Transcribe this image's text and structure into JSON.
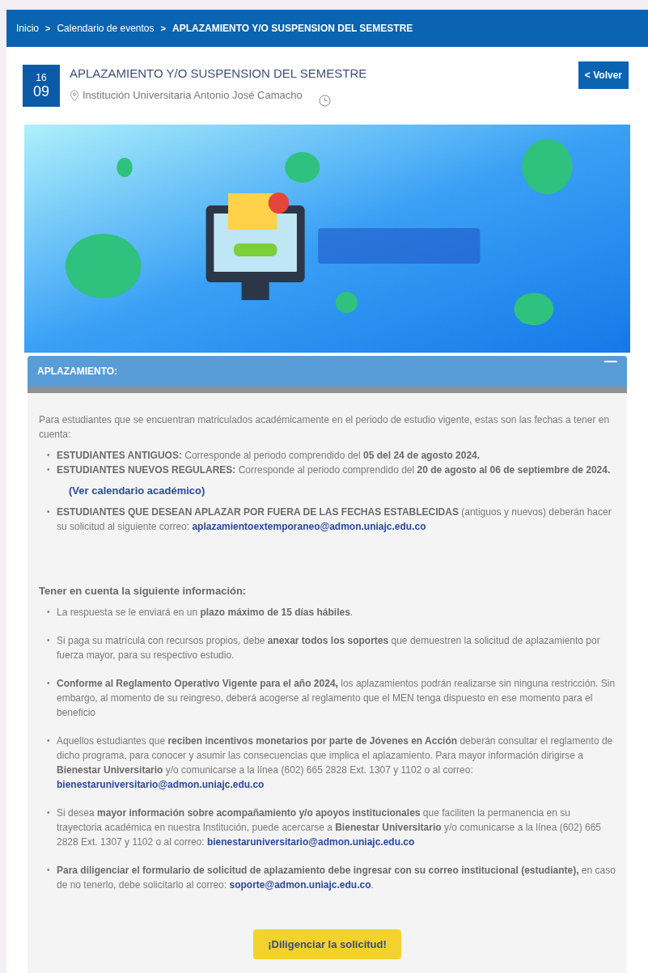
{
  "breadcrumb": [
    {
      "label": "Inicio",
      "current": false
    },
    {
      "label": "Calendario de eventos",
      "current": false
    },
    {
      "label": "APLAZAMIENTO Y/O SUSPENSION DEL SEMESTRE",
      "current": true
    }
  ],
  "breadcrumb_separator": ">",
  "bullet": "•",
  "event": {
    "day": "16",
    "month": "09",
    "title": "APLAZAMIENTO Y/O SUSPENSION DEL SEMESTRE",
    "location": "Institución Universitaria Antonio José Camacho"
  },
  "back_button": "< Volver",
  "panel": {
    "title": "APLAZAMIENTO:",
    "expanded": true,
    "intro": "Para estudiantes que se encuentran matriculados académicamente en el periodo de estudio vigente, estas son las fechas a tener en cuenta:",
    "dates": [
      [
        {
          "kind": "bold",
          "text": "ESTUDIANTES ANTIGUOS:"
        },
        {
          "kind": "plain",
          "text": " Corresponde al periodo comprendido del "
        },
        {
          "kind": "bold",
          "text": "05 del 24 de agosto 2024."
        }
      ],
      [
        {
          "kind": "bold",
          "text": "ESTUDIANTES NUEVOS REGULARES:"
        },
        {
          "kind": "plain",
          "text": " Corresponde al periodo comprendido del "
        },
        {
          "kind": "bold",
          "text": "20 de agosto al 06 de septiembre de 2024."
        }
      ]
    ],
    "calendar_link": "(Ver calendario académico)",
    "late": [
      [
        {
          "kind": "bold",
          "text": "ESTUDIANTES QUE DESEAN APLAZAR POR FUERA DE LAS FECHAS ESTABLECIDAS"
        },
        {
          "kind": "plain",
          "text": " (antiguos y nuevos) deberán hacer su solicitud al siguiente correo: "
        },
        {
          "kind": "link",
          "text": "aplazamientoextemporaneo@admon.uniajc.edu.co"
        }
      ]
    ],
    "info_heading": "Tener en cuenta la siguiente información:",
    "info": [
      [
        {
          "kind": "plain",
          "text": "La respuesta se le enviará en un "
        },
        {
          "kind": "bold",
          "text": "plazo máximo de 15 días hábiles"
        },
        {
          "kind": "plain",
          "text": "."
        }
      ],
      [
        {
          "kind": "plain",
          "text": "Si paga su matrícula con recursos propios, debe "
        },
        {
          "kind": "bold",
          "text": "anexar todos los soportes"
        },
        {
          "kind": "plain",
          "text": " que demuestren la solicitud de aplazamiento por fuerza mayor, para su respectivo estudio."
        }
      ],
      [
        {
          "kind": "bold",
          "text": "Conforme al Reglamento Operativo Vigente para el año 2024,"
        },
        {
          "kind": "plain",
          "text": " los aplazamientos podrán realizarse sin ninguna restricción. Sin embargo, al momento de su reingreso, deberá acogerse al reglamento que el MEN tenga dispuesto en ese momento para el beneficio"
        }
      ],
      [
        {
          "kind": "plain",
          "text": "Aquellos estudiantes que "
        },
        {
          "kind": "bold",
          "text": "reciben incentivos monetarios por parte de Jóvenes en Acción"
        },
        {
          "kind": "plain",
          "text": " deberán consultar el reglamento de dicho programa, para conocer y asumir las consecuencias que implica el aplazamiento. Para mayor información dirigirse a "
        },
        {
          "kind": "bold",
          "text": "Bienestar Universitario"
        },
        {
          "kind": "plain",
          "text": " y/o comunicarse a la línea (602) 665 2828 Ext. 1307 y 1102 o al correo: "
        },
        {
          "kind": "link",
          "text": "bienestaruniversitario@admon.uniajc.edu.co"
        }
      ],
      [
        {
          "kind": "plain",
          "text": "Si desea "
        },
        {
          "kind": "bold",
          "text": "mayor información sobre acompañamiento y/o apoyos institucionales"
        },
        {
          "kind": "plain",
          "text": " que faciliten la permanencia en su trayectoria académica en nuestra Institución, puede acercarse a "
        },
        {
          "kind": "bold",
          "text": "Bienestar Universitario"
        },
        {
          "kind": "plain",
          "text": " y/o comunicarse a la línea (602) 665 2828 Ext. 1307 y 1102 o al correo: "
        },
        {
          "kind": "link",
          "text": "bienestaruniversitario@admon.uniajc.edu.co"
        }
      ],
      [
        {
          "kind": "bold",
          "text": "Para diligenciar el formulario de solicitud de aplazamiento debe ingresar con su correo institucional (estudiante),"
        },
        {
          "kind": "plain",
          "text": " en caso de no tenerlo, debe solicitarlo al correo: "
        },
        {
          "kind": "link",
          "text": "soporte@admon.uniajc.edu.co"
        },
        {
          "kind": "plain",
          "text": "."
        }
      ]
    ],
    "button": "¡Diligenciar la solicitud!"
  }
}
